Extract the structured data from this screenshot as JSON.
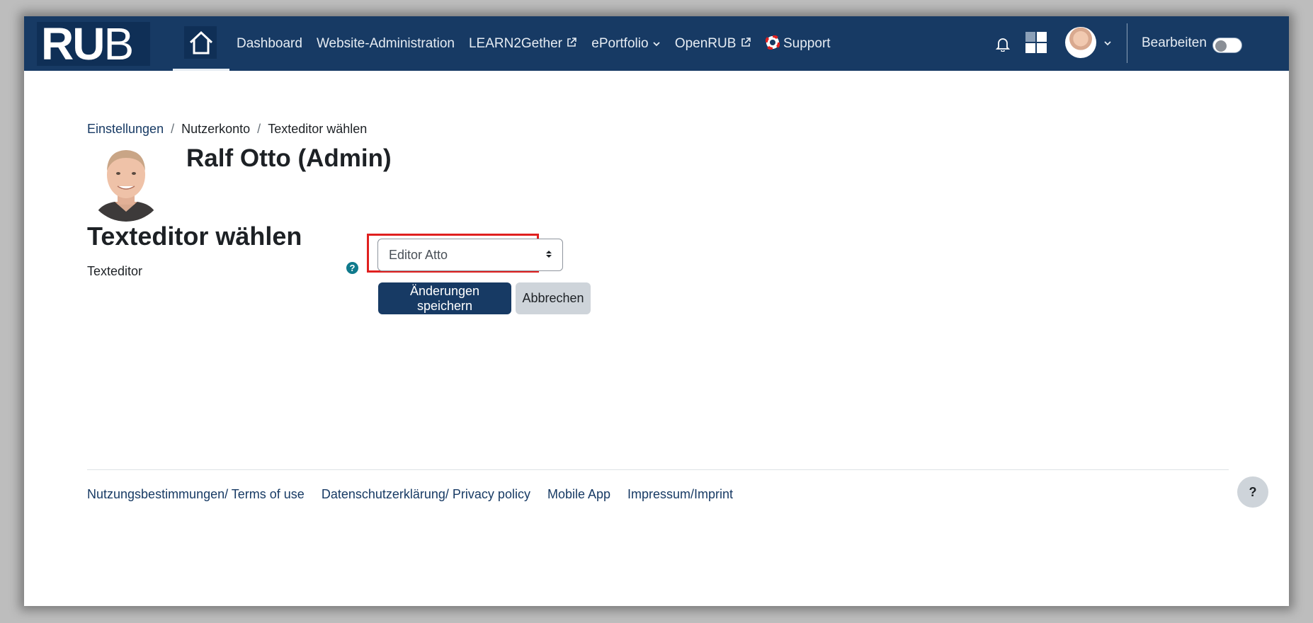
{
  "navbar": {
    "logo_text": "RUB",
    "links": [
      "Dashboard",
      "Website-Administration",
      "LEARN2Gether",
      "ePortfolio",
      "OpenRUB",
      "Support"
    ],
    "edit_label": "Bearbeiten",
    "edit_mode_on": false
  },
  "breadcrumb": {
    "item1": "Einstellungen",
    "item2": "Nutzerkonto",
    "item3": "Texteditor wählen",
    "separator": "/"
  },
  "profile": {
    "name": "Ralf Otto (Admin)"
  },
  "page": {
    "heading": "Texteditor wählen"
  },
  "form": {
    "field_label": "Texteditor",
    "help_symbol": "?",
    "selected_editor": "Editor Atto",
    "save_label": "Änderungen speichern",
    "cancel_label": "Abbrechen"
  },
  "footer": {
    "links": [
      "Nutzungsbestimmungen/ Terms of use",
      "Datenschutzerklärung/ Privacy policy",
      "Mobile App",
      "Impressum/Imprint"
    ],
    "help_symbol": "?"
  },
  "colors": {
    "navbar_bg": "#173a64",
    "primary": "#173a64",
    "highlight": "#e0201f",
    "help_icon": "#0f7a8c"
  }
}
